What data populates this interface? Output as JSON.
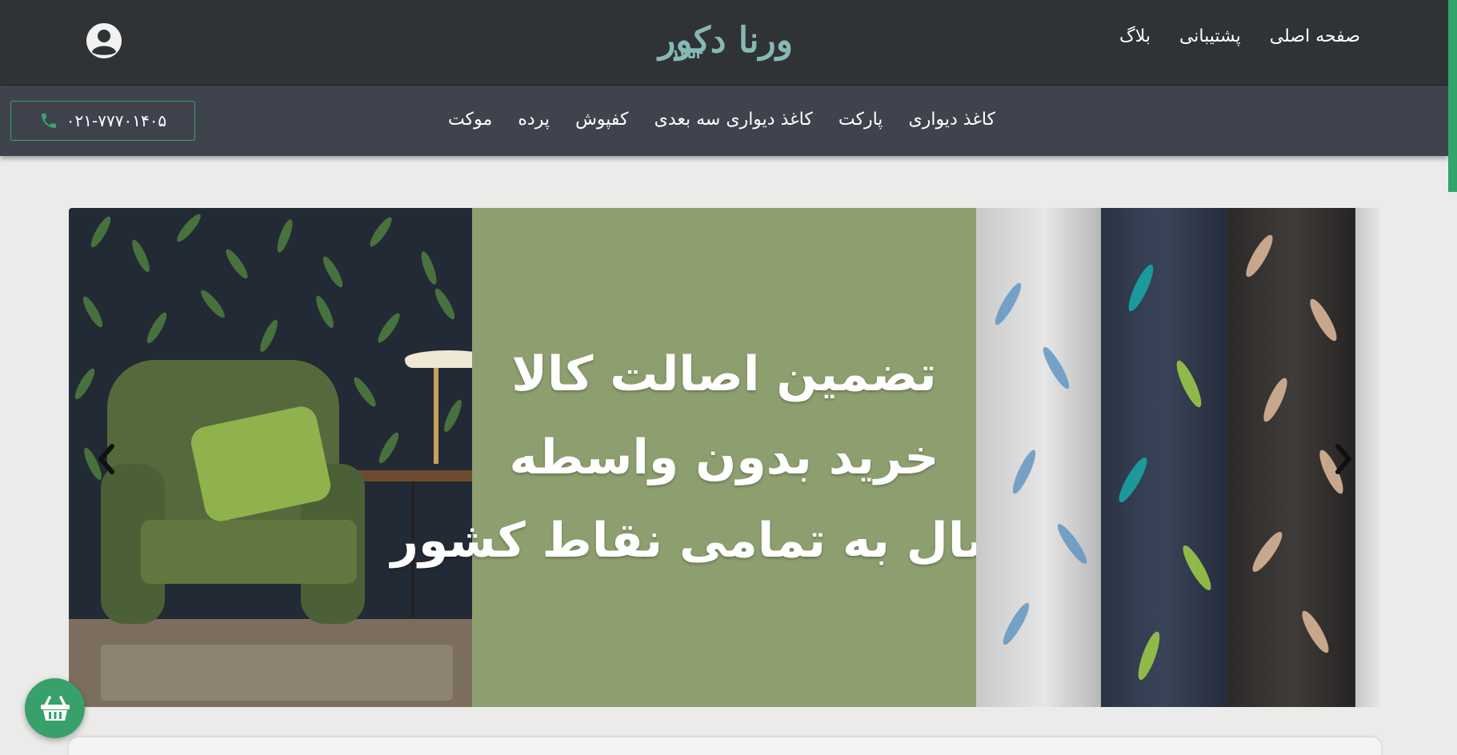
{
  "header": {
    "logo_text": "ورنا دکور",
    "logo_year": "۱۳۵۴",
    "nav": [
      {
        "label": "صفحه اصلی"
      },
      {
        "label": "پشتیبانی"
      },
      {
        "label": "بلاگ"
      }
    ],
    "user_icon": "user-circle-icon"
  },
  "subnav": {
    "phone": "۰۲۱-۷۷۷۰۱۴۰۵",
    "phone_icon": "phone-icon",
    "categories": [
      {
        "label": "کاغذ دیواری"
      },
      {
        "label": "پارکت"
      },
      {
        "label": "کاغذ دیواری سه بعدی"
      },
      {
        "label": "کفپوش"
      },
      {
        "label": "پرده"
      },
      {
        "label": "موکت"
      }
    ]
  },
  "slider": {
    "lines": [
      "تضمین اصالت کالا",
      "خرید بدون واسطه",
      "ارسال به تمامی نقاط کشور"
    ],
    "prev_icon": "chevron-left-icon",
    "next_icon": "chevron-right-icon"
  },
  "cart": {
    "icon": "basket-icon"
  },
  "colors": {
    "header_bg": "#303335",
    "subnav_bg": "#3f434e",
    "accent_green": "#38a06a",
    "banner_green": "#8d9f6f",
    "logo_teal": "#86b9b5"
  }
}
